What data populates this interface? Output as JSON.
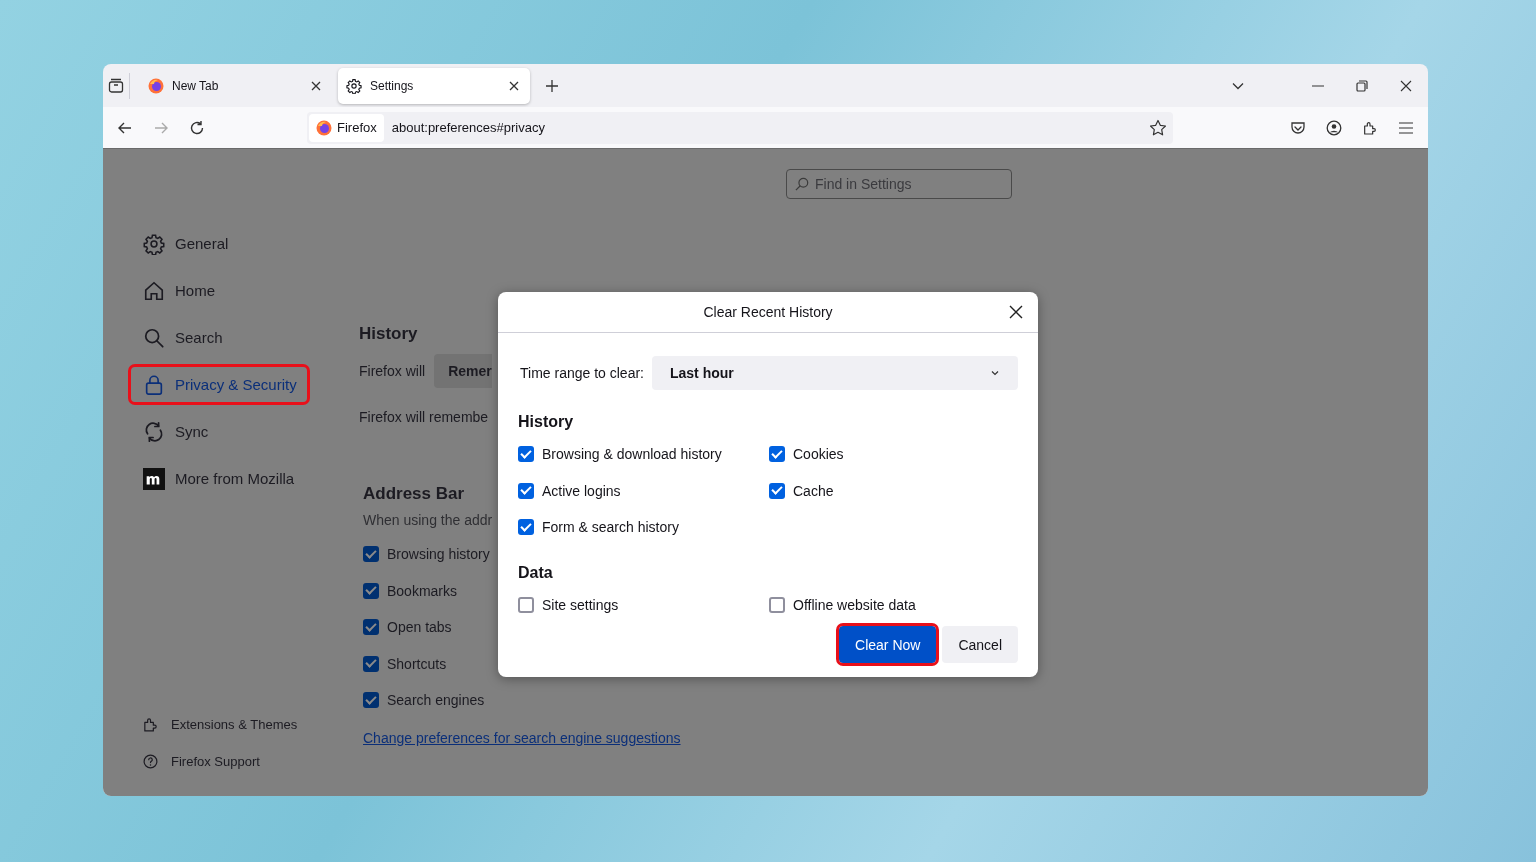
{
  "tabs": [
    {
      "title": "New Tab",
      "selected": false
    },
    {
      "title": "Settings",
      "selected": true
    }
  ],
  "toolbar": {
    "identity": "Firefox",
    "url": "about:preferences#privacy"
  },
  "settings": {
    "search": {
      "placeholder": "Find in Settings"
    },
    "sidebar": {
      "items": [
        {
          "label": "General",
          "selected": false,
          "highlighted": false
        },
        {
          "label": "Home",
          "selected": false,
          "highlighted": false
        },
        {
          "label": "Search",
          "selected": false,
          "highlighted": false
        },
        {
          "label": "Privacy & Security",
          "selected": true,
          "highlighted": true
        },
        {
          "label": "Sync",
          "selected": false,
          "highlighted": false
        },
        {
          "label": "More from Mozilla",
          "selected": false,
          "highlighted": false
        }
      ],
      "footer": [
        {
          "label": "Extensions & Themes"
        },
        {
          "label": "Firefox Support"
        }
      ]
    },
    "history": {
      "heading": "History",
      "mode_label": "Firefox will",
      "mode_value": "Remer",
      "note": "Firefox will remembe"
    },
    "address_bar": {
      "heading": "Address Bar",
      "description": "When using the addr",
      "options": [
        {
          "label": "Browsing history",
          "checked": true
        },
        {
          "label": "Bookmarks",
          "checked": true
        },
        {
          "label": "Open tabs",
          "checked": true
        },
        {
          "label": "Shortcuts",
          "checked": true
        },
        {
          "label": "Search engines",
          "checked": true
        }
      ],
      "link": "Change preferences for search engine suggestions"
    }
  },
  "dialog": {
    "title": "Clear Recent History",
    "time_range": {
      "label": "Time range to clear:",
      "value": "Last hour"
    },
    "sections": [
      {
        "heading": "History",
        "items": [
          {
            "label": "Browsing & download history",
            "checked": true
          },
          {
            "label": "Cookies",
            "checked": true
          },
          {
            "label": "Active logins",
            "checked": true
          },
          {
            "label": "Cache",
            "checked": true
          },
          {
            "label": "Form & search history",
            "checked": true
          }
        ]
      },
      {
        "heading": "Data",
        "items": [
          {
            "label": "Site settings",
            "checked": false
          },
          {
            "label": "Offline website data",
            "checked": false
          }
        ]
      }
    ],
    "buttons": [
      {
        "label": "Clear Now",
        "kind": "primary",
        "highlighted": true
      },
      {
        "label": "Cancel",
        "kind": "secondary",
        "highlighted": false
      }
    ]
  }
}
